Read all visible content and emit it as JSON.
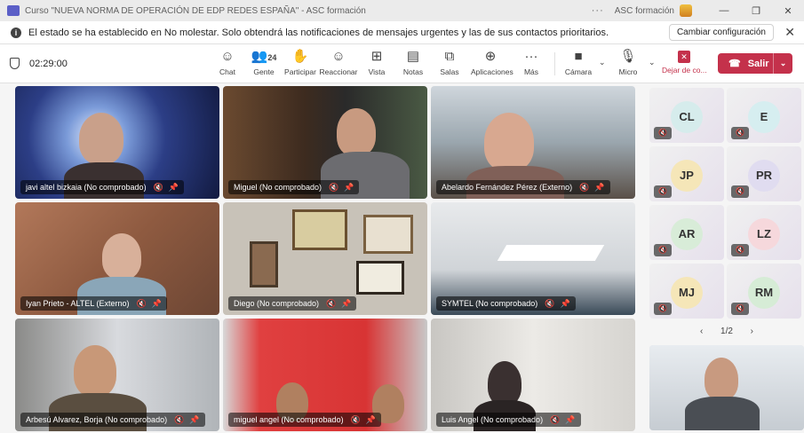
{
  "titlebar": {
    "title": "Curso \"NUEVA NORMA DE OPERACIÓN DE EDP REDES ESPAÑA\" - ASC formación",
    "more": "···",
    "org": "ASC formación",
    "minimize": "—",
    "maximize": "❐",
    "close": "✕"
  },
  "notice": {
    "icon": "i",
    "text": "El estado se ha establecido en No molestar. Solo obtendrá las notificaciones de mensajes urgentes y las de sus contactos prioritarios.",
    "button": "Cambiar configuración",
    "close": "✕"
  },
  "meeting": {
    "timer": "02:29:00"
  },
  "toolbar": {
    "chat": {
      "icon": "☺",
      "label": "Chat"
    },
    "people": {
      "icon": "👥",
      "label": "Gente",
      "count": "24"
    },
    "raise": {
      "icon": "✋",
      "label": "Participar"
    },
    "react": {
      "icon": "☺",
      "label": "Reaccionar"
    },
    "view": {
      "icon": "⊞",
      "label": "Vista"
    },
    "notes": {
      "icon": "▤",
      "label": "Notas"
    },
    "rooms": {
      "icon": "⧉",
      "label": "Salas"
    },
    "apps": {
      "icon": "⊕",
      "label": "Aplicaciones"
    },
    "more": {
      "icon": "···",
      "label": "Más"
    },
    "camera": {
      "icon": "■",
      "label": "Cámara"
    },
    "mic": {
      "icon": "🎙",
      "label": "Micro"
    },
    "share": {
      "icon": "✕",
      "label": "Dejar de co..."
    },
    "chevron": "⌄",
    "leave": {
      "label": "Salir",
      "icon": "☎",
      "chevron": "⌄"
    }
  },
  "participants": [
    {
      "name": "javi altel bizkaia (No comprobado)"
    },
    {
      "name": "Miguel (No comprobado)"
    },
    {
      "name": "Abelardo Fernández Pérez (Externo)"
    },
    {
      "name": "Iyan Prieto - ALTEL (Externo)"
    },
    {
      "name": "Diego (No comprobado)"
    },
    {
      "name": "SYMTEL (No comprobado)"
    },
    {
      "name": "Arbesú Alvarez, Borja (No comprobado)"
    },
    {
      "name": "miguel angel (No comprobado)"
    },
    {
      "name": "Luis Angel (No comprobado)"
    }
  ],
  "tile_icons": {
    "mic_off": "🔇",
    "pin": "📌"
  },
  "side_avatars": [
    {
      "initials": "CL",
      "color": "#d6ecec"
    },
    {
      "initials": "E",
      "color": "#d6eef0"
    },
    {
      "initials": "JP",
      "color": "#f5e6b8"
    },
    {
      "initials": "PR",
      "color": "#e0dcf0"
    },
    {
      "initials": "AR",
      "color": "#d8ecd8"
    },
    {
      "initials": "LZ",
      "color": "#f6d8dc"
    },
    {
      "initials": "MJ",
      "color": "#f5e6b8"
    },
    {
      "initials": "RM",
      "color": "#d6ecd6"
    }
  ],
  "pager": {
    "prev": "‹",
    "label": "1/2",
    "next": "›"
  }
}
